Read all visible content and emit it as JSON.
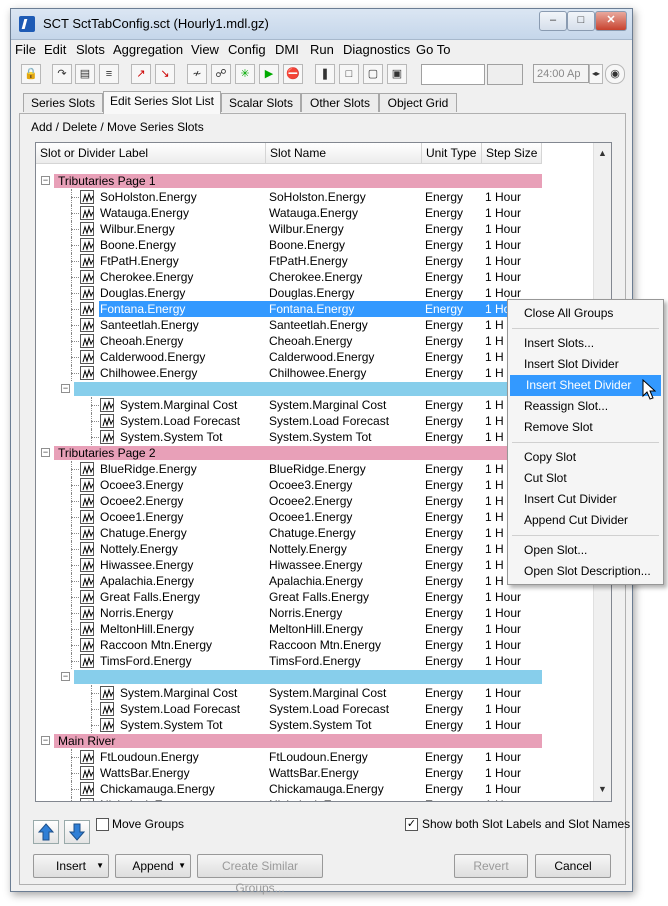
{
  "window": {
    "title": "SCT SctTabConfig.sct (Hourly1.mdl.gz)"
  },
  "menu": [
    "File",
    "Edit",
    "Slots",
    "Aggregation",
    "View",
    "Config",
    "DMI",
    "Run",
    "Diagnostics",
    "Go To"
  ],
  "toolbar": {
    "time_value": "24:00 Ap"
  },
  "tabs": [
    "Series Slots",
    "Edit Series Slot List",
    "Scalar Slots",
    "Other Slots",
    "Object Grid"
  ],
  "section_label": "Add / Delete / Move Series Slots",
  "columns": [
    "Slot or Divider Label",
    "Slot Name",
    "Unit Type",
    "Step Size"
  ],
  "rows": [
    {
      "kind": "group",
      "label": "Tributaries Page 1"
    },
    {
      "kind": "slot",
      "label": "SoHolston.Energy",
      "name": "SoHolston.Energy",
      "unit": "Energy",
      "step": "1 Hour"
    },
    {
      "kind": "slot",
      "label": "Watauga.Energy",
      "name": "Watauga.Energy",
      "unit": "Energy",
      "step": "1 Hour"
    },
    {
      "kind": "slot",
      "label": "Wilbur.Energy",
      "name": "Wilbur.Energy",
      "unit": "Energy",
      "step": "1 Hour"
    },
    {
      "kind": "slot",
      "label": "Boone.Energy",
      "name": "Boone.Energy",
      "unit": "Energy",
      "step": "1 Hour"
    },
    {
      "kind": "slot",
      "label": "FtPatH.Energy",
      "name": "FtPatH.Energy",
      "unit": "Energy",
      "step": "1 Hour"
    },
    {
      "kind": "slot",
      "label": "Cherokee.Energy",
      "name": "Cherokee.Energy",
      "unit": "Energy",
      "step": "1 Hour"
    },
    {
      "kind": "slot",
      "label": "Douglas.Energy",
      "name": "Douglas.Energy",
      "unit": "Energy",
      "step": "1 Hour"
    },
    {
      "kind": "slot",
      "label": "Fontana.Energy",
      "name": "Fontana.Energy",
      "unit": "Energy",
      "step": "1 Hour",
      "selected": true
    },
    {
      "kind": "slot",
      "label": "Santeetlah.Energy",
      "name": "Santeetlah.Energy",
      "unit": "Energy",
      "step": "1 H"
    },
    {
      "kind": "slot",
      "label": "Cheoah.Energy",
      "name": "Cheoah.Energy",
      "unit": "Energy",
      "step": "1 H"
    },
    {
      "kind": "slot",
      "label": "Calderwood.Energy",
      "name": "Calderwood.Energy",
      "unit": "Energy",
      "step": "1 H"
    },
    {
      "kind": "slot",
      "label": "Chilhowee.Energy",
      "name": "Chilhowee.Energy",
      "unit": "Energy",
      "step": "1 H"
    },
    {
      "kind": "divider"
    },
    {
      "kind": "subslot",
      "label": "System.Marginal Cost",
      "name": "System.Marginal Cost",
      "unit": "Energy",
      "step": "1 H"
    },
    {
      "kind": "subslot",
      "label": "System.Load Forecast",
      "name": "System.Load Forecast",
      "unit": "Energy",
      "step": "1 H"
    },
    {
      "kind": "subslot",
      "label": "System.System Tot",
      "name": "System.System Tot",
      "unit": "Energy",
      "step": "1 H"
    },
    {
      "kind": "group",
      "label": "Tributaries Page 2"
    },
    {
      "kind": "slot",
      "label": "BlueRidge.Energy",
      "name": "BlueRidge.Energy",
      "unit": "Energy",
      "step": "1 H"
    },
    {
      "kind": "slot",
      "label": "Ocoee3.Energy",
      "name": "Ocoee3.Energy",
      "unit": "Energy",
      "step": "1 H"
    },
    {
      "kind": "slot",
      "label": "Ocoee2.Energy",
      "name": "Ocoee2.Energy",
      "unit": "Energy",
      "step": "1 H"
    },
    {
      "kind": "slot",
      "label": "Ocoee1.Energy",
      "name": "Ocoee1.Energy",
      "unit": "Energy",
      "step": "1 H"
    },
    {
      "kind": "slot",
      "label": "Chatuge.Energy",
      "name": "Chatuge.Energy",
      "unit": "Energy",
      "step": "1 H"
    },
    {
      "kind": "slot",
      "label": "Nottely.Energy",
      "name": "Nottely.Energy",
      "unit": "Energy",
      "step": "1 H"
    },
    {
      "kind": "slot",
      "label": "Hiwassee.Energy",
      "name": "Hiwassee.Energy",
      "unit": "Energy",
      "step": "1 H"
    },
    {
      "kind": "slot",
      "label": "Apalachia.Energy",
      "name": "Apalachia.Energy",
      "unit": "Energy",
      "step": "1 H"
    },
    {
      "kind": "slot",
      "label": "Great Falls.Energy",
      "name": "Great Falls.Energy",
      "unit": "Energy",
      "step": "1 Hour"
    },
    {
      "kind": "slot",
      "label": "Norris.Energy",
      "name": "Norris.Energy",
      "unit": "Energy",
      "step": "1 Hour"
    },
    {
      "kind": "slot",
      "label": "MeltonHill.Energy",
      "name": "MeltonHill.Energy",
      "unit": "Energy",
      "step": "1 Hour"
    },
    {
      "kind": "slot",
      "label": "Raccoon Mtn.Energy",
      "name": "Raccoon Mtn.Energy",
      "unit": "Energy",
      "step": "1 Hour"
    },
    {
      "kind": "slot",
      "label": "TimsFord.Energy",
      "name": "TimsFord.Energy",
      "unit": "Energy",
      "step": "1 Hour"
    },
    {
      "kind": "divider"
    },
    {
      "kind": "subslot",
      "label": "System.Marginal Cost",
      "name": "System.Marginal Cost",
      "unit": "Energy",
      "step": "1 Hour"
    },
    {
      "kind": "subslot",
      "label": "System.Load Forecast",
      "name": "System.Load Forecast",
      "unit": "Energy",
      "step": "1 Hour"
    },
    {
      "kind": "subslot",
      "label": "System.System Tot",
      "name": "System.System Tot",
      "unit": "Energy",
      "step": "1 Hour"
    },
    {
      "kind": "group",
      "label": "Main River"
    },
    {
      "kind": "slot",
      "label": "FtLoudoun.Energy",
      "name": "FtLoudoun.Energy",
      "unit": "Energy",
      "step": "1 Hour"
    },
    {
      "kind": "slot",
      "label": "WattsBar.Energy",
      "name": "WattsBar.Energy",
      "unit": "Energy",
      "step": "1 Hour"
    },
    {
      "kind": "slot",
      "label": "Chickamauga.Energy",
      "name": "Chickamauga.Energy",
      "unit": "Energy",
      "step": "1 Hour"
    },
    {
      "kind": "slot",
      "label": "Nickajack.Energy",
      "name": "Nickajack.Energy",
      "unit": "Energy",
      "step": "1 Hour"
    }
  ],
  "bottom": {
    "move_groups_label": "Move Groups",
    "move_groups_checked": false,
    "show_both_label": "Show both Slot Labels and Slot Names",
    "show_both_checked": true,
    "insert_label": "Insert",
    "append_label": "Append",
    "create_similar_label": "Create Similar Groups...",
    "revert_label": "Revert",
    "cancel_label": "Cancel"
  },
  "context_menu": [
    {
      "label": "Close All Groups"
    },
    {
      "sep": true
    },
    {
      "label": "Insert Slots..."
    },
    {
      "label": "Insert Slot Divider"
    },
    {
      "label": "Insert Sheet Divider",
      "highlighted": true
    },
    {
      "label": "Reassign Slot..."
    },
    {
      "label": "Remove Slot"
    },
    {
      "sep": true
    },
    {
      "label": "Copy Slot"
    },
    {
      "label": "Cut Slot"
    },
    {
      "label": "Insert Cut Divider"
    },
    {
      "label": "Append Cut Divider"
    },
    {
      "sep": true
    },
    {
      "label": "Open Slot..."
    },
    {
      "label": "Open Slot Description..."
    }
  ]
}
